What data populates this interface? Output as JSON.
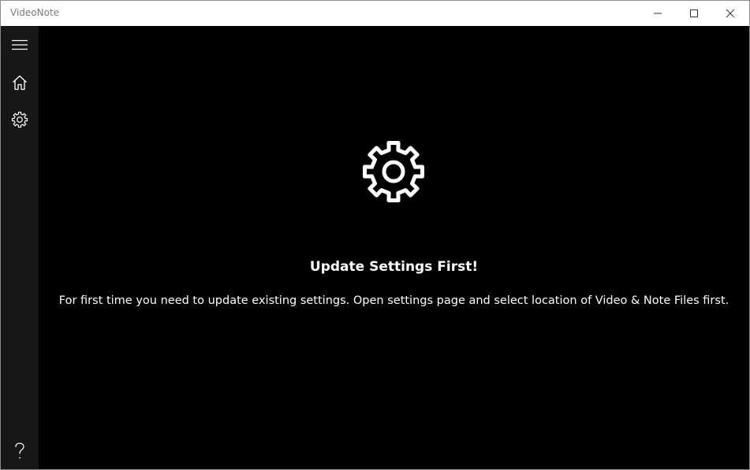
{
  "window": {
    "title": "VideoNote",
    "controls": [
      "minimize-icon",
      "maximize-icon",
      "close-icon"
    ]
  },
  "sidebar": {
    "items": [
      {
        "name": "menu",
        "icon": "hamburger-icon"
      },
      {
        "name": "home",
        "icon": "home-icon"
      },
      {
        "name": "settings",
        "icon": "gear-icon"
      },
      {
        "name": "help",
        "icon": "question-icon"
      }
    ],
    "help_glyph": "?"
  },
  "main": {
    "icon": "gear-icon",
    "heading": "Update Settings First!",
    "message": "For first time you need to update existing settings. Open settings page and select location of Video & Note Files first."
  },
  "colors": {
    "background": "#000000",
    "sidebar": "#171717",
    "titlebar": "#ffffff",
    "text": "#ffffff"
  }
}
